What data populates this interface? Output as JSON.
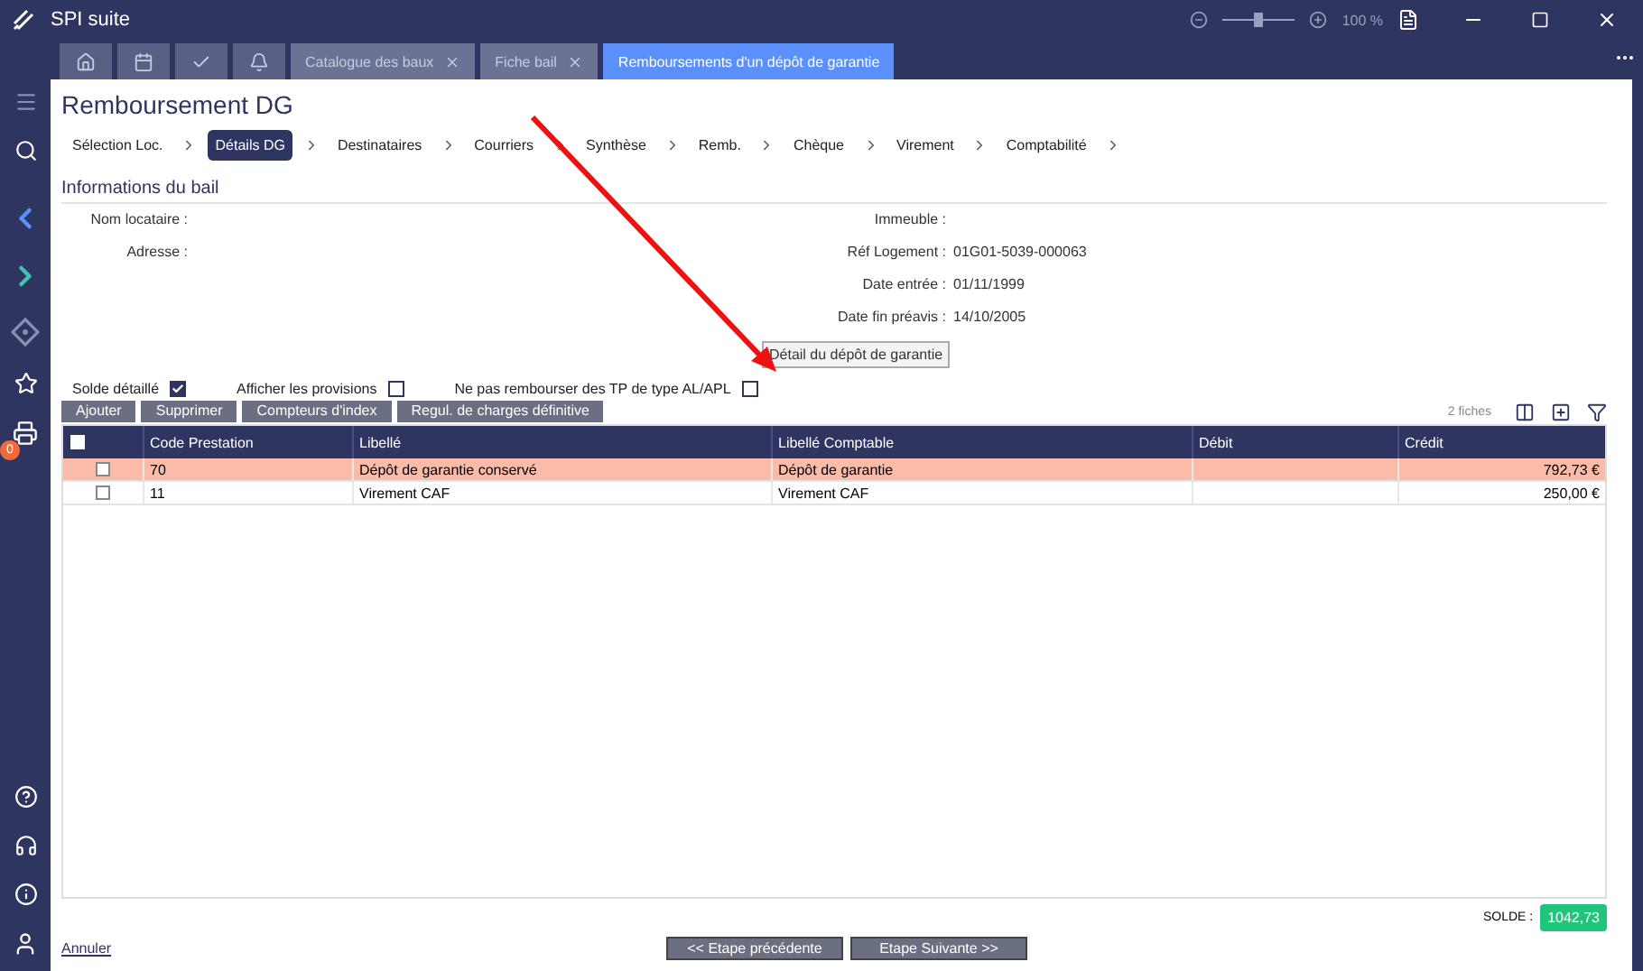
{
  "window": {
    "title": "SPI suite",
    "zoom": "100 %",
    "zoom_slider": {
      "level": 0.5
    }
  },
  "tabs": [
    {
      "kind": "icon",
      "selected": false
    },
    {
      "kind": "icon",
      "selected": false
    },
    {
      "kind": "icon",
      "selected": false
    },
    {
      "kind": "icon",
      "selected": false
    },
    {
      "kind": "text",
      "label": "Catalogue des baux",
      "closable": true,
      "selected": false
    },
    {
      "kind": "text",
      "label": "Fiche bail",
      "closable": true,
      "selected": false
    },
    {
      "kind": "text",
      "label": "Remboursements d'un dépôt de garantie",
      "closable": false,
      "selected": true
    }
  ],
  "sidebar": {
    "print_badge": "0"
  },
  "page_title": "Remboursement DG",
  "steps": [
    {
      "label": "Sélection Loc.",
      "selected": false
    },
    {
      "label": "Détails DG",
      "selected": true
    },
    {
      "label": "Destinataires",
      "selected": false
    },
    {
      "label": "Courriers",
      "selected": false
    },
    {
      "label": "Synthèse",
      "selected": false
    },
    {
      "label": "Remb.",
      "selected": false
    },
    {
      "label": "Chèque",
      "selected": false
    },
    {
      "label": "Virement",
      "selected": false
    },
    {
      "label": "Comptabilité",
      "selected": false
    }
  ],
  "section_title": "Informations du bail",
  "info_left": [
    {
      "label": "Nom locataire :"
    },
    {
      "label": "Adresse :"
    }
  ],
  "info_right": [
    {
      "label": "Immeuble :"
    },
    {
      "label": "Réf Logement :",
      "value": "01G01-5039-000063"
    },
    {
      "label": "Date entrée :",
      "value": "01/11/1999"
    },
    {
      "label": "Date fin préavis :",
      "value": "14/10/2005"
    }
  ],
  "tooltip": "Détail du dépôt de garantie",
  "options": [
    {
      "label": "Solde détaillé",
      "checked": true
    },
    {
      "label": "Afficher les provisions",
      "checked": false
    },
    {
      "label": "Ne pas rembourser des TP de type AL/APL",
      "checked": false
    }
  ],
  "actions": [
    "Ajouter",
    "Supprimer",
    "Compteurs d'index",
    "Regul. de charges définitive"
  ],
  "record_count": "2 fiches",
  "table": {
    "all_checked": false,
    "columns": [
      "Code Prestation",
      "Libellé",
      "Libellé Comptable",
      "Débit",
      "Crédit"
    ],
    "rows": [
      {
        "highlighted": true,
        "checked": false,
        "cells": [
          "70",
          "Dépôt de garantie conservé",
          "Dépôt de garantie",
          "",
          "792,73 €"
        ]
      },
      {
        "highlighted": false,
        "checked": false,
        "cells": [
          "11",
          "Virement CAF",
          "Virement CAF",
          "",
          "250,00 €"
        ]
      }
    ]
  },
  "solde": {
    "label": "SOLDE :",
    "value": "1042,73"
  },
  "cancel": "Annuler",
  "nav": [
    "<< Etape précédente",
    "Etape Suivante >>"
  ]
}
